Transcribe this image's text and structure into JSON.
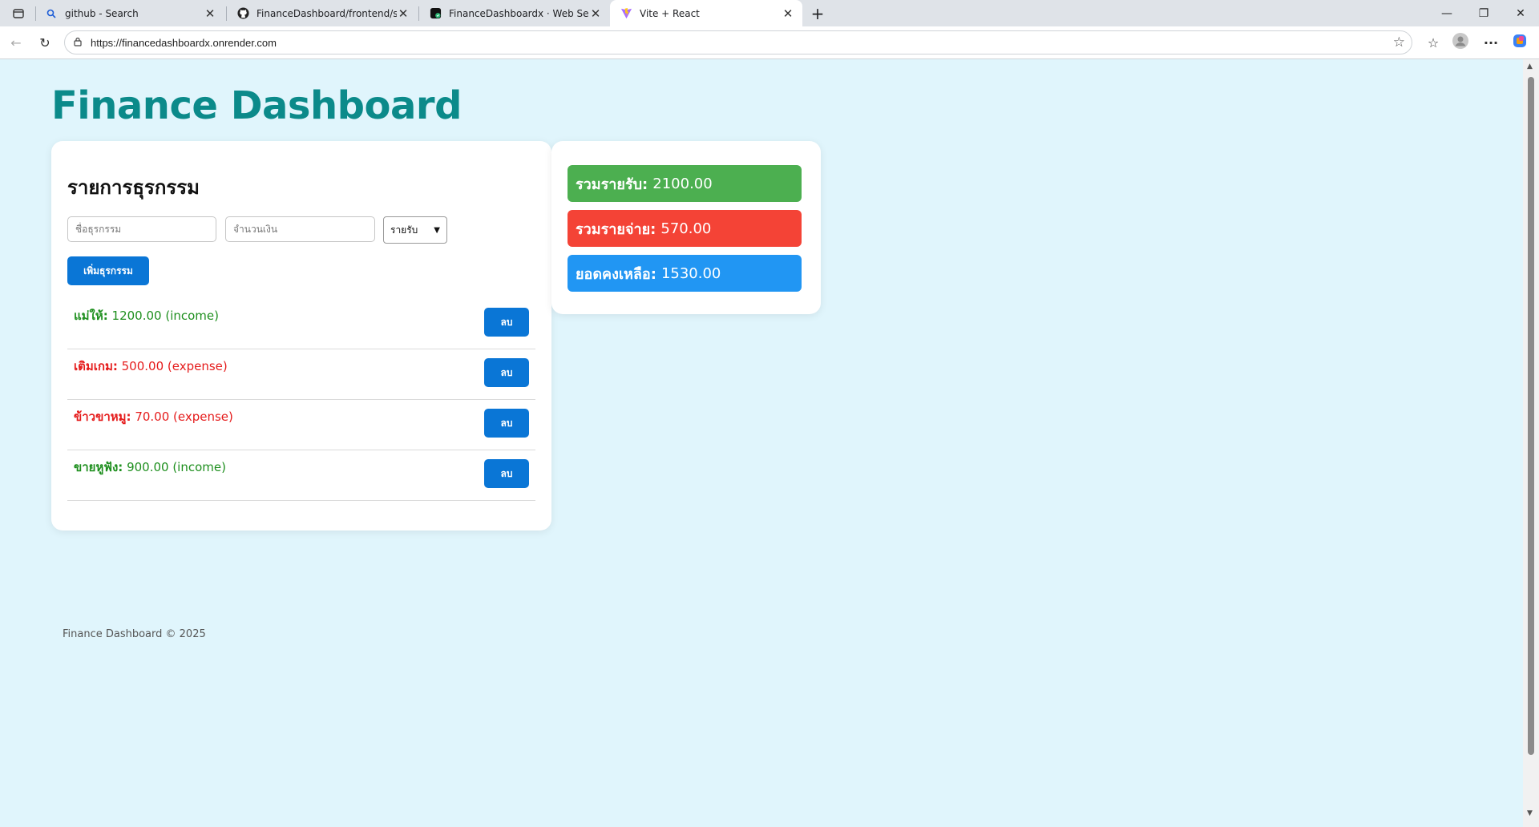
{
  "browser": {
    "tabs": [
      {
        "title": "github - Search",
        "icon": "search-icon"
      },
      {
        "title": "FinanceDashboard/frontend/src a",
        "icon": "github-icon"
      },
      {
        "title": "FinanceDashboardx · Web Servic",
        "icon": "render-icon"
      },
      {
        "title": "Vite + React",
        "icon": "vite-icon"
      }
    ],
    "url": "https://financedashboardx.onrender.com"
  },
  "page": {
    "title": "Finance Dashboard",
    "transactions": {
      "heading": "รายการธุรกรรม",
      "name_placeholder": "ชื่อธุรกรรม",
      "amount_placeholder": "จำนวนเงิน",
      "type_selected": "รายรับ",
      "add_label": "เพิ่มธุรกรรม",
      "delete_label": "ลบ",
      "items": [
        {
          "name": "แม่ให้:",
          "detail": " 1200.00 (income)",
          "type": "income"
        },
        {
          "name": "เติมเกม:",
          "detail": " 500.00 (expense)",
          "type": "expense"
        },
        {
          "name": "ข้าวขาหมู:",
          "detail": " 70.00 (expense)",
          "type": "expense"
        },
        {
          "name": "ขายหูฟัง:",
          "detail": " 900.00 (income)",
          "type": "income"
        }
      ]
    },
    "summary": {
      "income_label": "รวมรายรับ:",
      "income_value": "2100.00",
      "expense_label": "รวมรายจ่าย:",
      "expense_value": "570.00",
      "balance_label": "ยอดคงเหลือ:",
      "balance_value": "1530.00"
    },
    "footer": "Finance Dashboard © 2025"
  },
  "colors": {
    "income": "#4caf50",
    "expense": "#f44336",
    "balance": "#2196f3",
    "title": "#0b8a8a",
    "button": "#0a76d6"
  }
}
